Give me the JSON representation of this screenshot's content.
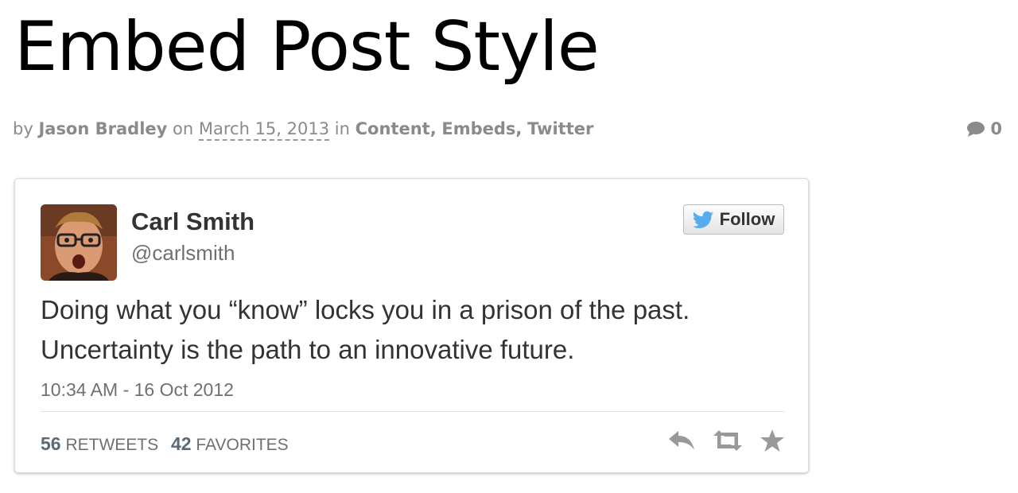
{
  "post": {
    "title": "Embed Post Style",
    "by_label": "by",
    "author": "Jason Bradley",
    "on_label": "on",
    "date": "March 15, 2013",
    "in_label": "in",
    "categories": [
      "Content",
      "Embeds",
      "Twitter"
    ],
    "comment_count": "0"
  },
  "tweet": {
    "name": "Carl Smith",
    "handle": "@carlsmith",
    "follow_label": "Follow",
    "text": "Doing what you “know” locks you in a prison of the past. Uncertainty is the path to an innovative future.",
    "timestamp": "10:34 AM - 16 Oct 2012",
    "retweets_count": "56",
    "retweets_label": "RETWEETS",
    "favorites_count": "42",
    "favorites_label": "FAVORITES"
  },
  "icons": {
    "comment": "speech-bubble-icon",
    "twitter": "twitter-bird-icon",
    "reply": "reply-icon",
    "retweet": "retweet-icon",
    "favorite": "star-icon"
  },
  "colors": {
    "twitter_blue": "#55acee",
    "meta_gray": "#8a8a8a",
    "action_gray": "#999999"
  }
}
